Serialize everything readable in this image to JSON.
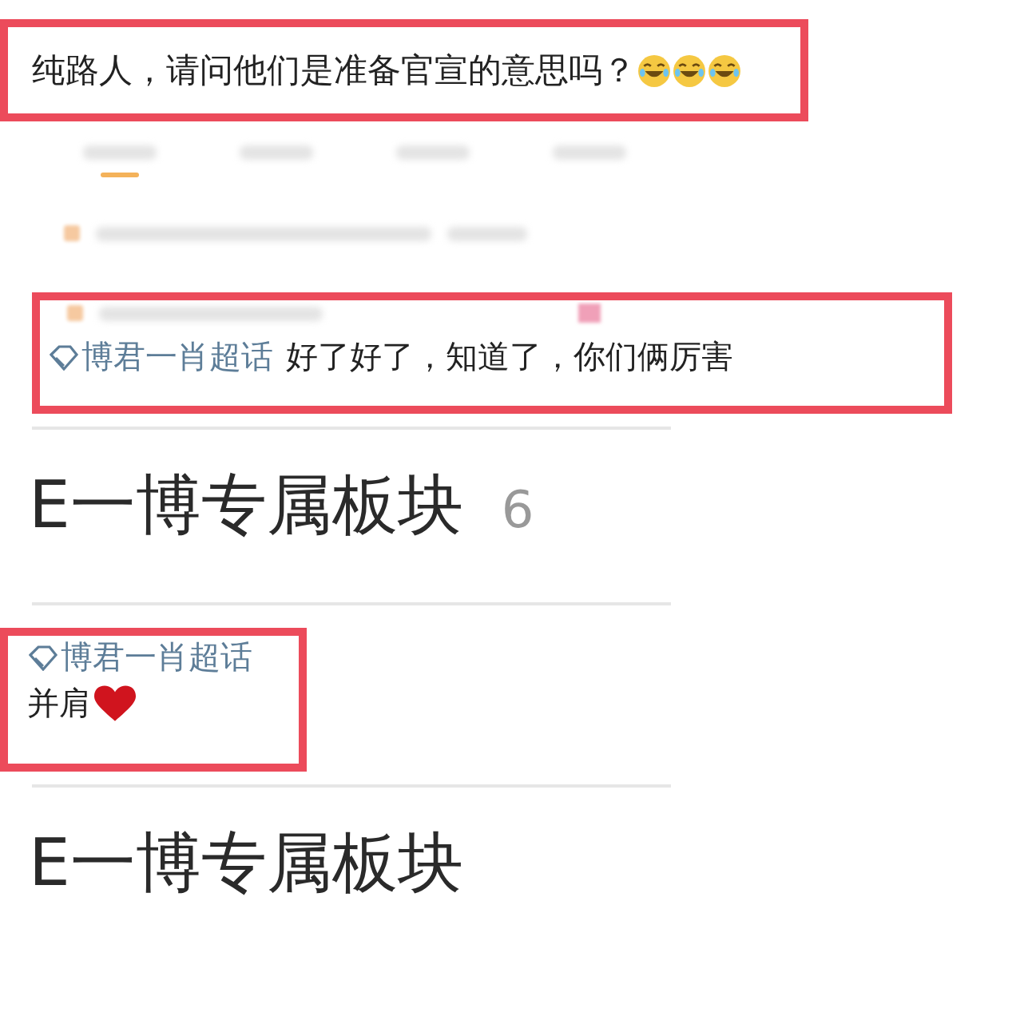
{
  "question": {
    "text": "纯路人，请问他们是准备官宣的意思吗？",
    "emoji": [
      {
        "kind": "laugh-cry"
      },
      {
        "kind": "laugh-cry"
      },
      {
        "kind": "laugh-cry"
      }
    ]
  },
  "tabs_blurred": [
    {
      "selected": true
    },
    {
      "selected": false
    },
    {
      "selected": false
    },
    {
      "selected": false
    }
  ],
  "posts": [
    {
      "topic": "博君一肖超话",
      "text": "好了好了，知道了，你们俩厉害",
      "section_title": "E一博专属板块",
      "section_count": "6"
    },
    {
      "topic": "博君一肖超话",
      "text": "并肩",
      "emoji": [
        {
          "kind": "heart"
        }
      ],
      "section_title": "E一博专属板块"
    }
  ]
}
